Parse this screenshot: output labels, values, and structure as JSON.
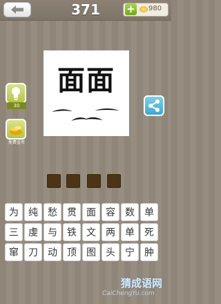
{
  "header": {
    "level": "371",
    "coins": "980",
    "back_icon": "back-arrow-icon",
    "add_icon": "plus-icon",
    "coin_icon": "coin-icon"
  },
  "puzzle": {
    "text": "面面"
  },
  "side": {
    "hint_cost": "30",
    "free_coins_label": "免费金币",
    "hint_icon": "lightbulb-icon",
    "coin_pile_icon": "gold-coins-icon",
    "share_icon": "share-icon"
  },
  "answer_slots": [
    "",
    "",
    "",
    ""
  ],
  "keys": [
    "为",
    "纯",
    "愁",
    "贯",
    "面",
    "容",
    "数",
    "单",
    "三",
    "虔",
    "与",
    "铁",
    "文",
    "两",
    "单",
    "死",
    "窜",
    "刀",
    "动",
    "顶",
    "图",
    "头",
    "宁",
    "肿"
  ],
  "watermark": {
    "title": "猜成语网",
    "url": "CaiChengYu.com"
  },
  "colors": {
    "background": "#8f8579",
    "slot": "#4b3516",
    "hint_button": "#c8d36a",
    "share_button": "#5ab8dd"
  }
}
